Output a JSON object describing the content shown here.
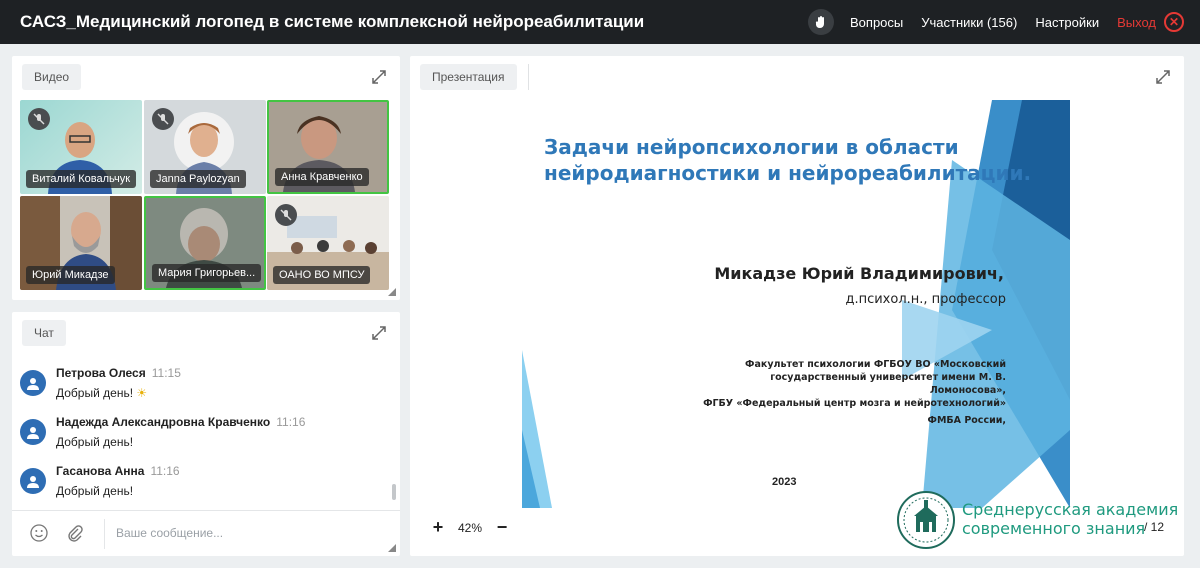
{
  "header": {
    "title": "САСЗ_Медицинский логопед в системе комплексной нейрореабилитации",
    "questions_label": "Вопросы",
    "participants_label": "Участники (156)",
    "settings_label": "Настройки",
    "exit_label": "Выход"
  },
  "video_panel": {
    "tab_label": "Видео",
    "tiles": [
      {
        "name": "Виталий Ковальчук",
        "muted": true,
        "active": false
      },
      {
        "name": "Janna Paylozyan",
        "muted": true,
        "active": false
      },
      {
        "name": "Анна Кравченко",
        "muted": false,
        "active": true
      },
      {
        "name": "Юрий Микадзе",
        "muted": false,
        "active": false
      },
      {
        "name": "Мария Григорьев...",
        "muted": false,
        "active": true
      },
      {
        "name": "ОАНО ВО МПСУ",
        "muted": true,
        "active": false
      }
    ]
  },
  "chat_panel": {
    "tab_label": "Чат",
    "messages": [
      {
        "author": "Петрова Олеся",
        "time": "11:15",
        "text": "Добрый день!"
      },
      {
        "author": "Надежда Александровна Кравченко",
        "time": "11:16",
        "text": "Добрый день!"
      },
      {
        "author": "Гасанова Анна",
        "time": "11:16",
        "text": "Добрый день!"
      }
    ],
    "input_placeholder": "Ваше сообщение..."
  },
  "presentation_panel": {
    "tab_label": "Презентация",
    "slide": {
      "title_line1": "Задачи нейропсихологии в области",
      "title_line2": "нейродиагностики и нейрореабилитации.",
      "author": "Микадзе Юрий Владимирович,",
      "degree": "д.психол.н., профессор",
      "aff_line1": "Факультет психологии ФГБОУ ВО «Московский",
      "aff_line2": "государственный университет имени М. В.",
      "aff_line3": "Ломоносова»,",
      "aff_line4": "ФГБУ «Федеральный центр мозга и нейротехнологий»",
      "aff_line5": "ФМБА России,",
      "year": "2023"
    },
    "zoom_value": "42%",
    "zoom_in": "+",
    "zoom_out": "−",
    "page_total": "12"
  },
  "watermark": {
    "line1": "Среднерусская академия",
    "line2": "современного знания"
  },
  "colors": {
    "topbar": "#1e2124",
    "exit": "#e53935",
    "active_border": "#43c443",
    "slide_title": "#2f78b8",
    "watermark": "#1f9a7f"
  }
}
